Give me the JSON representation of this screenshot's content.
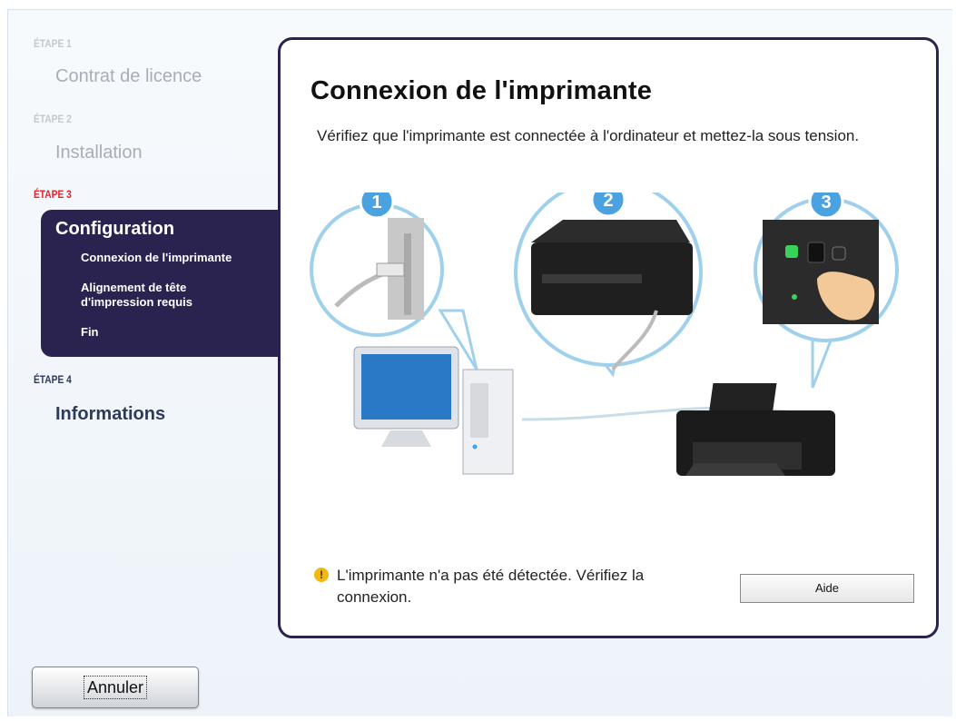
{
  "sidebar": {
    "steps": [
      {
        "label": "ÉTAPE 1",
        "title": "Contrat de licence"
      },
      {
        "label": "ÉTAPE 2",
        "title": "Installation"
      },
      {
        "label": "ÉTAPE 3",
        "title": "Configuration",
        "substeps": [
          "Connexion de l'imprimante",
          "Alignement de tête d'impression requis",
          "Fin"
        ]
      },
      {
        "label": "ÉTAPE 4",
        "title": "Informations"
      }
    ]
  },
  "content": {
    "title": "Connexion de l'imprimante",
    "instructions": "Vérifiez que l'imprimante est connectée à l'ordinateur et mettez-la sous tension.",
    "illustration_badges": [
      "1",
      "2",
      "3"
    ],
    "status_icon": "warning-icon",
    "status_text": "L'imprimante n'a pas été détectée. Vérifiez la connexion.",
    "help_button_label": "Aide"
  },
  "footer": {
    "cancel_label": "Annuler"
  },
  "colors": {
    "accent": "#2a2350",
    "active_step": "#e4202a",
    "badge": "#4aa3e0"
  }
}
